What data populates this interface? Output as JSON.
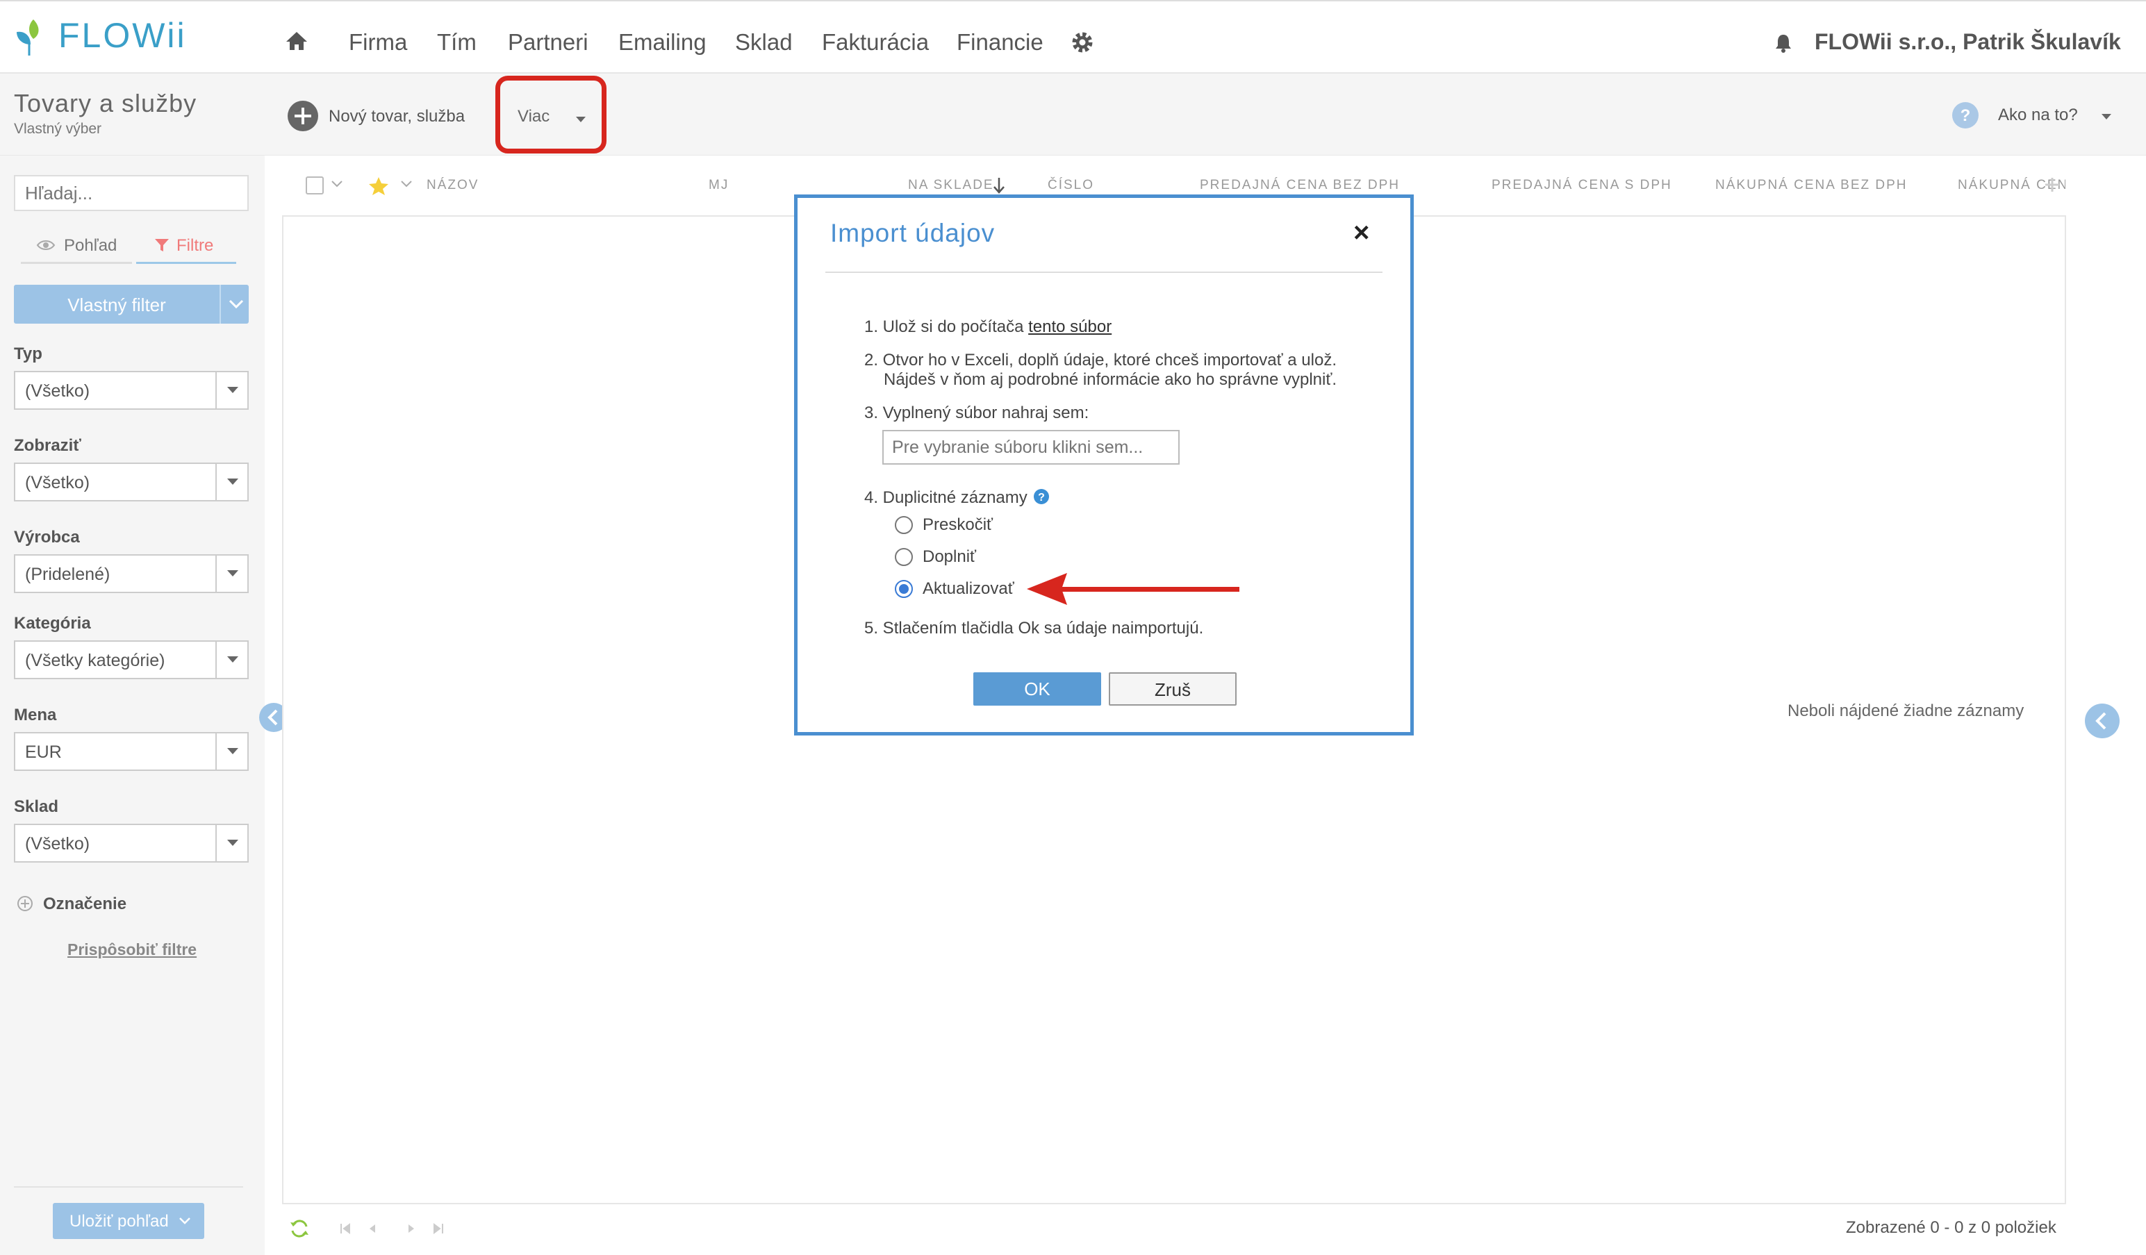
{
  "app": {
    "logo_text": "FLOWii"
  },
  "nav": {
    "items": [
      "Firma",
      "Tím",
      "Partneri",
      "Emailing",
      "Sklad",
      "Fakturácia",
      "Financie"
    ],
    "user": "FLOWii s.r.o., Patrik Škulavík"
  },
  "page": {
    "title": "Tovary a služby",
    "subtitle": "Vlastný výber"
  },
  "toolbar": {
    "new_item": "Nový tovar, služba",
    "more": "Viac",
    "help": "Ako na to?"
  },
  "sidebar": {
    "search_placeholder": "Hľadaj...",
    "tab_view": "Pohľad",
    "tab_filters": "Filtre",
    "custom_filter": "Vlastný filter",
    "filters": [
      {
        "label": "Typ",
        "value": "(Všetko)"
      },
      {
        "label": "Zobraziť",
        "value": "(Všetko)"
      },
      {
        "label": "Výrobca",
        "value": "(Pridelené)"
      },
      {
        "label": "Kategória",
        "value": "(Všetky kategórie)"
      },
      {
        "label": "Mena",
        "value": "EUR"
      },
      {
        "label": "Sklad",
        "value": "(Všetko)"
      }
    ],
    "tag_label": "Označenie",
    "customize_filters": "Prispôsobiť filtre",
    "save_view": "Uložiť pohľad"
  },
  "grid": {
    "columns": [
      "NÁZOV",
      "MJ",
      "NA SKLADE",
      "ČÍSLO",
      "PREDAJNÁ CENA BEZ DPH",
      "PREDAJNÁ CENA S DPH",
      "NÁKUPNÁ CENA BEZ DPH",
      "NÁKUPNÁ CENA"
    ],
    "empty_text": "Neboli nájdené žiadne záznamy",
    "footer": "Zobrazené 0 - 0 z 0 položiek"
  },
  "modal": {
    "title": "Import údajov",
    "close": "×",
    "step1_text": "1. Ulož si do počítača",
    "step1_link": "tento súbor",
    "step2_line1": "2. Otvor ho v Exceli, doplň údaje, ktoré chceš importovať a ulož.",
    "step2_line2": "Nájdeš v ňom aj podrobné informácie ako ho správne vyplniť.",
    "step3_text": "3. Vyplnený súbor nahraj sem:",
    "file_placeholder": "Pre vybranie súboru klikni sem...",
    "step4_text": "4. Duplicitné záznamy",
    "options": [
      "Preskočiť",
      "Doplniť",
      "Aktualizovať"
    ],
    "selected_option": "Aktualizovať",
    "step5_text": "5. Stlačením tlačidla Ok sa údaje naimportujú.",
    "ok": "OK",
    "cancel": "Zruš"
  },
  "colors": {
    "accent": "#3a9fc8",
    "modal_border": "#4a8fd0",
    "highlight_box": "#d7261e",
    "arrow": "#d7261e",
    "filter_tab": "#f07a7a",
    "ok_button": "#5a9bd4"
  }
}
